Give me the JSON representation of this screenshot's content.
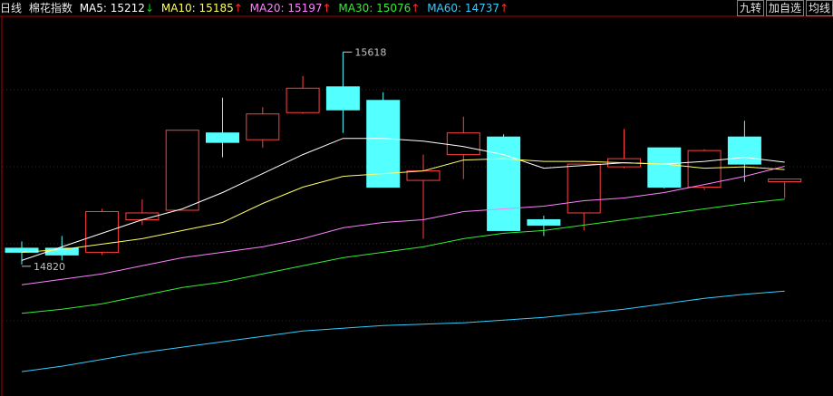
{
  "header": {
    "period": "日线",
    "index_name": "棉花指数",
    "ma5_label": "MA5:",
    "ma5_value": "15212",
    "ma5_arrow": "↓",
    "ma10_label": "MA10:",
    "ma10_value": "15185",
    "ma10_arrow": "↑",
    "ma20_label": "MA20:",
    "ma20_value": "15197",
    "ma20_arrow": "↑",
    "ma30_label": "MA30:",
    "ma30_value": "15076",
    "ma30_arrow": "↑",
    "ma60_label": "MA60:",
    "ma60_value": "14737",
    "ma60_arrow": "↑"
  },
  "buttons": {
    "jiuzhuan": "九转",
    "add_watch": "加自选",
    "avg_line": "均线"
  },
  "colors": {
    "background": "#000000",
    "up": "#ff4040",
    "down": "#54ffff",
    "ma5": "#ffffff",
    "ma10": "#ffff66",
    "ma20": "#ff80ff",
    "ma30": "#33ee33",
    "ma60": "#33ccff",
    "grid": "#8b0000"
  },
  "chart_data": {
    "type": "candlestick",
    "ylim": [
      14350,
      15750
    ],
    "annotations": {
      "high_label": "15618",
      "low_label": "14820"
    },
    "candles": [
      {
        "o": 14895,
        "c": 14880,
        "h": 14920,
        "l": 14835
      },
      {
        "o": 14895,
        "c": 14870,
        "h": 14940,
        "l": 14850
      },
      {
        "o": 14880,
        "c": 15030,
        "h": 15040,
        "l": 14870
      },
      {
        "o": 15000,
        "c": 15025,
        "h": 15075,
        "l": 14980
      },
      {
        "o": 15035,
        "c": 15330,
        "h": 15330,
        "l": 15035
      },
      {
        "o": 15320,
        "c": 15285,
        "h": 15450,
        "l": 15230
      },
      {
        "o": 15295,
        "c": 15390,
        "h": 15415,
        "l": 15265
      },
      {
        "o": 15395,
        "c": 15485,
        "h": 15530,
        "l": 15390
      },
      {
        "o": 15490,
        "c": 15405,
        "h": 15618,
        "l": 15320
      },
      {
        "o": 15440,
        "c": 15120,
        "h": 15470,
        "l": 15120
      },
      {
        "o": 15145,
        "c": 15180,
        "h": 15240,
        "l": 14930
      },
      {
        "o": 15240,
        "c": 15320,
        "h": 15380,
        "l": 15150
      },
      {
        "o": 15305,
        "c": 14960,
        "h": 15315,
        "l": 14960
      },
      {
        "o": 15000,
        "c": 14980,
        "h": 15015,
        "l": 14940
      },
      {
        "o": 15025,
        "c": 15205,
        "h": 15205,
        "l": 14960
      },
      {
        "o": 15195,
        "c": 15225,
        "h": 15335,
        "l": 15190
      },
      {
        "o": 15265,
        "c": 15120,
        "h": 15265,
        "l": 15115
      },
      {
        "o": 15120,
        "c": 15255,
        "h": 15260,
        "l": 15110
      },
      {
        "o": 15305,
        "c": 15205,
        "h": 15365,
        "l": 15140
      },
      {
        "o": 15140,
        "c": 15150,
        "h": 15150,
        "l": 15080
      }
    ],
    "series": [
      {
        "name": "MA5",
        "values": [
          14850,
          14900,
          14950,
          15000,
          15040,
          15100,
          15170,
          15240,
          15300,
          15300,
          15290,
          15270,
          15240,
          15190,
          15200,
          15210,
          15205,
          15215,
          15230,
          15212
        ]
      },
      {
        "name": "MA10",
        "values": [
          14880,
          14890,
          14910,
          14930,
          14960,
          14990,
          15060,
          15120,
          15160,
          15170,
          15180,
          15220,
          15225,
          15215,
          15215,
          15210,
          15205,
          15190,
          15195,
          15185
        ]
      },
      {
        "name": "MA20",
        "values": [
          14760,
          14780,
          14800,
          14830,
          14860,
          14880,
          14900,
          14930,
          14970,
          14990,
          15000,
          15030,
          15040,
          15050,
          15070,
          15080,
          15100,
          15130,
          15160,
          15197
        ]
      },
      {
        "name": "MA30",
        "values": [
          14655,
          14670,
          14690,
          14720,
          14750,
          14770,
          14800,
          14830,
          14860,
          14880,
          14900,
          14930,
          14950,
          14960,
          14980,
          15000,
          15020,
          15040,
          15060,
          15076
        ]
      },
      {
        "name": "MA60",
        "values": [
          14440,
          14460,
          14485,
          14510,
          14530,
          14550,
          14570,
          14590,
          14600,
          14610,
          14615,
          14620,
          14630,
          14640,
          14655,
          14670,
          14690,
          14710,
          14725,
          14737
        ]
      }
    ]
  }
}
